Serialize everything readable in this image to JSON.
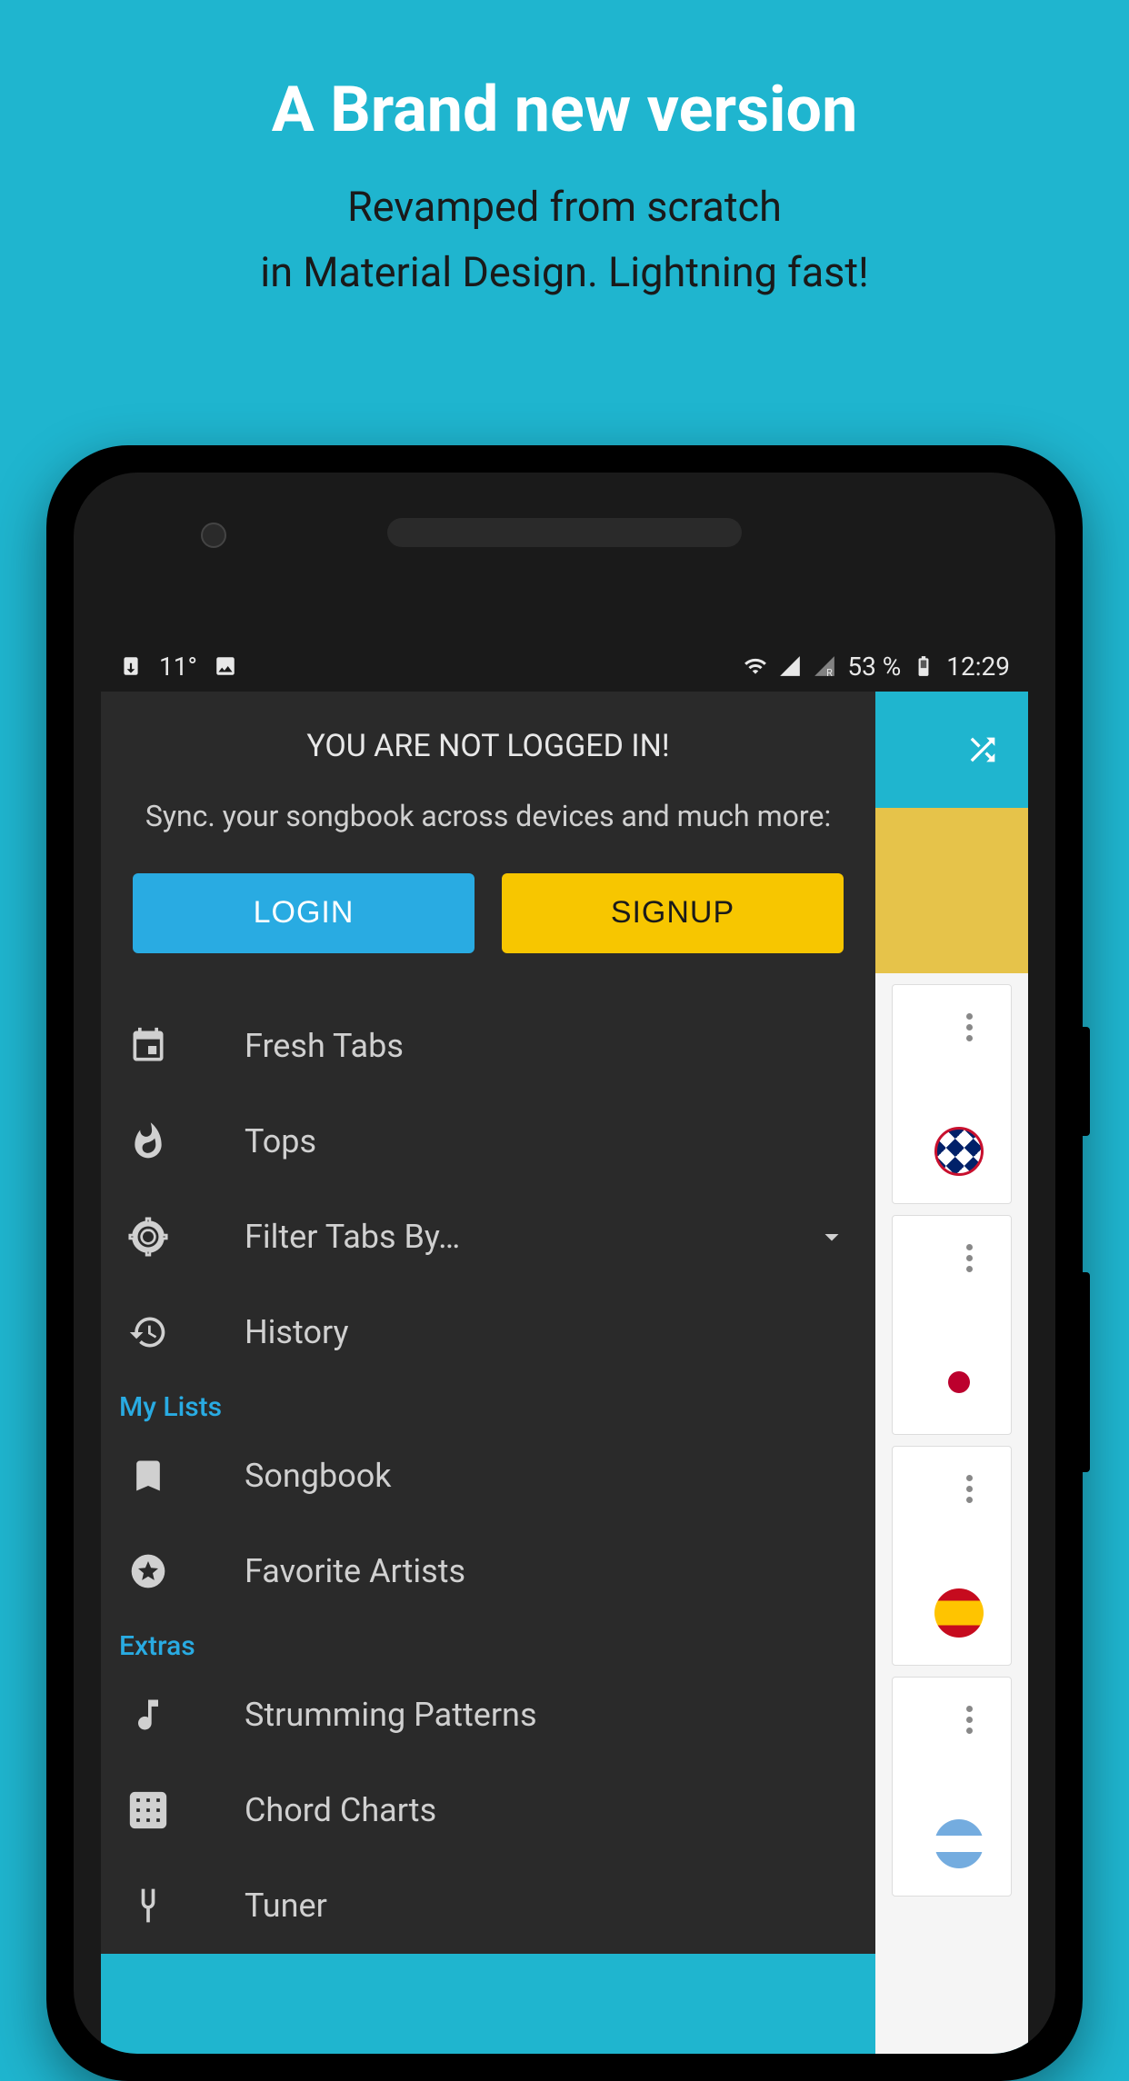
{
  "promo": {
    "title": "A Brand new version",
    "subtitle_line1": "Revamped from scratch",
    "subtitle_line2": "in Material Design. Lightning fast!"
  },
  "status_bar": {
    "temperature": "11°",
    "battery_percent": "53 %",
    "time": "12:29"
  },
  "drawer": {
    "title": "YOU ARE NOT LOGGED IN!",
    "subtitle": "Sync. your songbook across devices and much more:",
    "login_label": "LOGIN",
    "signup_label": "SIGNUP",
    "menu": {
      "fresh_tabs": "Fresh Tabs",
      "tops": "Tops",
      "filter": "Filter Tabs By…",
      "history": "History",
      "songbook": "Songbook",
      "favorite_artists": "Favorite Artists",
      "strumming": "Strumming Patterns",
      "chord_charts": "Chord Charts",
      "tuner": "Tuner"
    },
    "sections": {
      "my_lists": "My Lists",
      "extras": "Extras"
    }
  }
}
